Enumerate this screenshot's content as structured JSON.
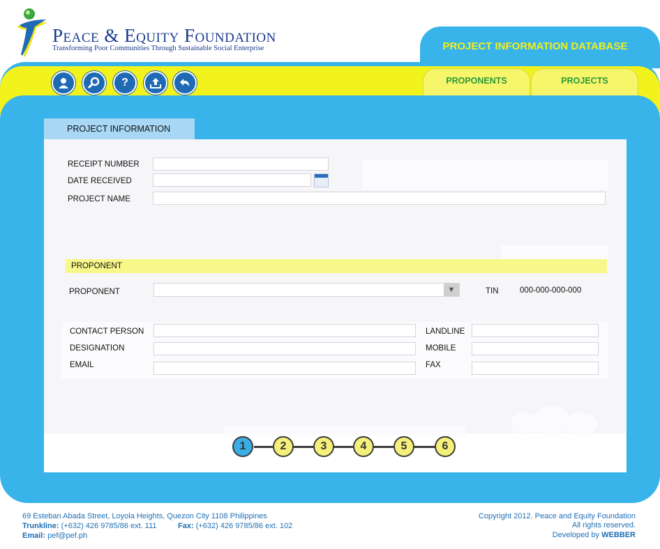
{
  "header": {
    "org_name": "Peace & Equity Foundation",
    "tagline": "Transforming Poor Communities Through Sustainable Social Enterprise",
    "db_title": "PROJECT INFORMATION DATABASE"
  },
  "toolbar": {
    "icons": [
      "user-icon",
      "search-icon",
      "help-icon",
      "upload-icon",
      "undo-icon"
    ],
    "help_glyph": "?"
  },
  "nav": {
    "tabs": [
      "PROPONENTS",
      "PROJECTS"
    ]
  },
  "section": {
    "title": "PROJECT INFORMATION"
  },
  "project": {
    "receipt_label": "RECEIPT NUMBER",
    "receipt_value": "",
    "date_label": "DATE RECEIVED",
    "date_value": "",
    "name_label": "PROJECT NAME",
    "name_value": ""
  },
  "proponent": {
    "section_title": "PROPONENT",
    "label": "PROPONENT",
    "selected": "",
    "tin_label": "TIN",
    "tin_value": "000-000-000-000",
    "contact_label": "CONTACT PERSON",
    "designation_label": "DESIGNATION",
    "email_label": "EMAIL",
    "landline_label": "LANDLINE",
    "mobile_label": "MOBILE",
    "fax_label": "FAX"
  },
  "steps": {
    "items": [
      "1",
      "2",
      "3",
      "4",
      "5",
      "6"
    ],
    "current": 1
  },
  "footer": {
    "address": "69 Esteban Abada Street, Loyola Heights, Quezon City 1108 Philippines",
    "trunkline_label": "Trunkline:",
    "trunkline_value": "(+632) 426 9785/86 ext. 111",
    "fax_label": "Fax:",
    "fax_value": "(+632) 426 9785/86 ext. 102",
    "email_label": "Email:",
    "email_value": "pef@pef.ph",
    "copyright": "Copyright 2012. Peace and Equity Foundation",
    "rights": "All rights reserved.",
    "developed_by": "Developed by",
    "developer": "WEBBER"
  },
  "colors": {
    "blue": "#38b4ea",
    "yellow": "#f2f21d",
    "navy": "#1a3a8c",
    "green_text": "#2a9a3a"
  }
}
